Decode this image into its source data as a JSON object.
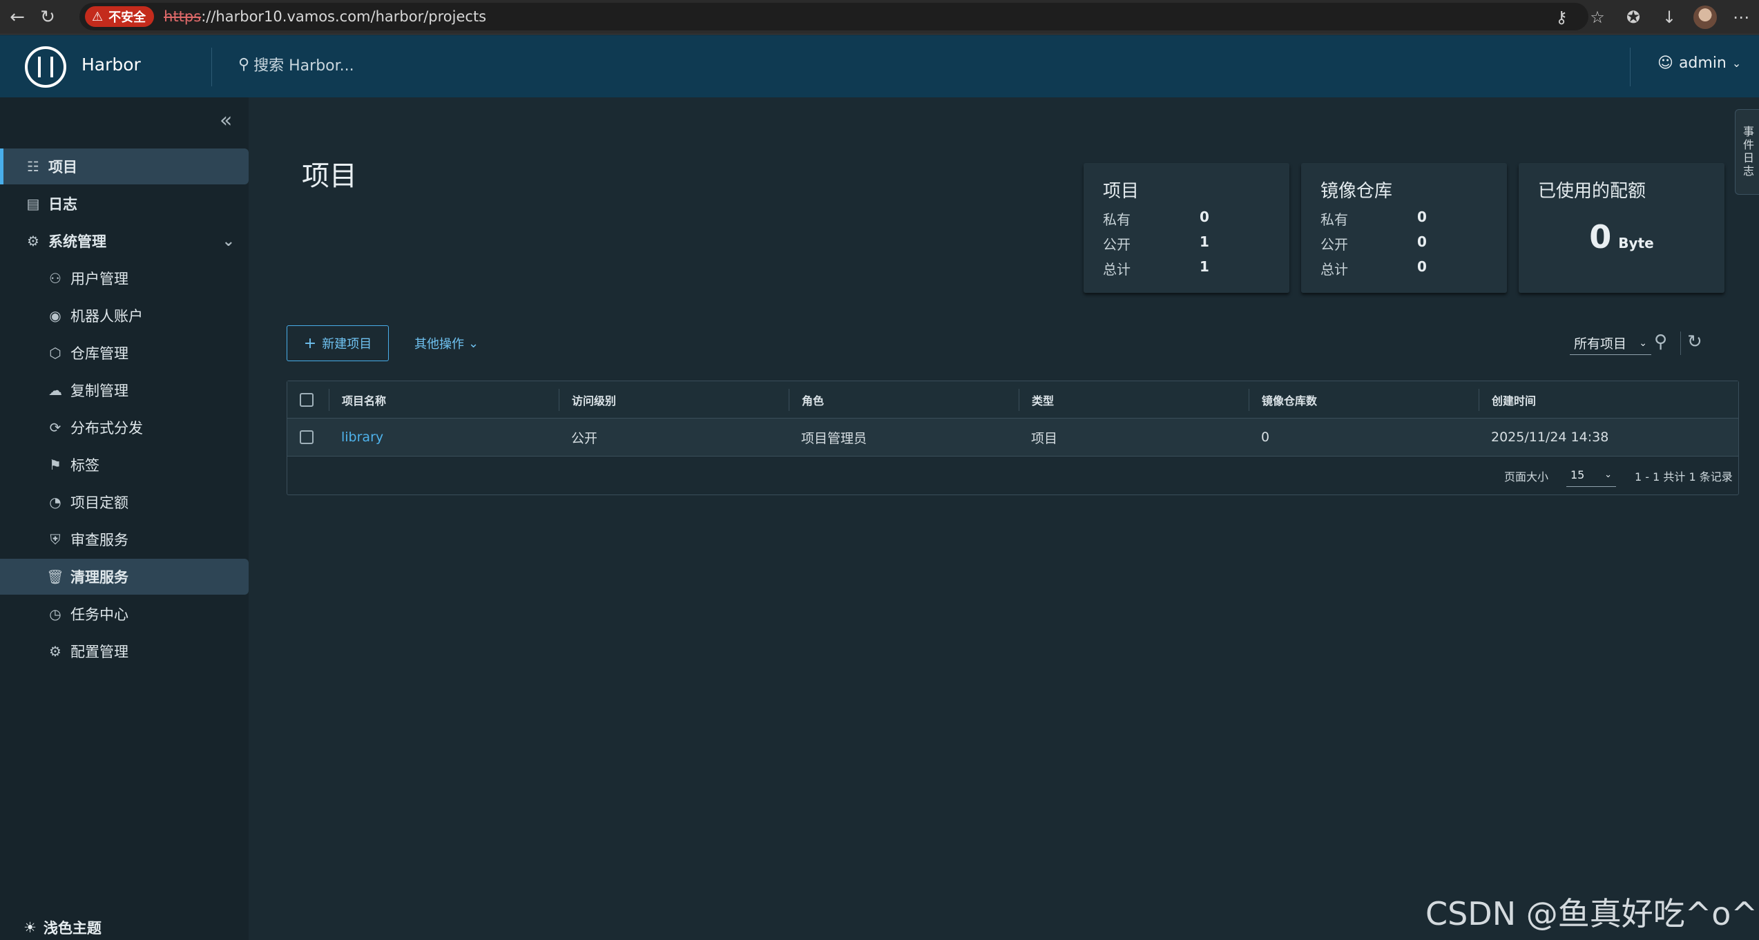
{
  "browser": {
    "security_label": "不安全",
    "url_scheme": "https",
    "url_rest": "://harbor10.vamos.com/harbor/projects"
  },
  "header": {
    "brand": "Harbor",
    "search_placeholder": "搜索 Harbor...",
    "user": "admin"
  },
  "sidebar": {
    "items": [
      {
        "label": "项目",
        "icon": "projects-icon"
      },
      {
        "label": "日志",
        "icon": "log-icon"
      },
      {
        "label": "系统管理",
        "icon": "admin-icon"
      },
      {
        "label": "用户管理",
        "icon": "users-icon"
      },
      {
        "label": "机器人账户",
        "icon": "robot-icon"
      },
      {
        "label": "仓库管理",
        "icon": "registry-icon"
      },
      {
        "label": "复制管理",
        "icon": "replication-icon"
      },
      {
        "label": "分布式分发",
        "icon": "share-icon"
      },
      {
        "label": "标签",
        "icon": "tag-icon"
      },
      {
        "label": "项目定额",
        "icon": "quota-icon"
      },
      {
        "label": "审查服务",
        "icon": "shield-icon"
      },
      {
        "label": "清理服务",
        "icon": "trash-icon"
      },
      {
        "label": "任务中心",
        "icon": "dashboard-icon"
      },
      {
        "label": "配置管理",
        "icon": "gear-icon"
      }
    ],
    "theme_toggle": "浅色主题"
  },
  "edge_tab": "事件日志",
  "main": {
    "title": "项目",
    "cards": {
      "projects": {
        "title": "项目",
        "rows": [
          {
            "label": "私有",
            "value": "0"
          },
          {
            "label": "公开",
            "value": "1"
          },
          {
            "label": "总计",
            "value": "1"
          }
        ]
      },
      "repos": {
        "title": "镜像仓库",
        "rows": [
          {
            "label": "私有",
            "value": "0"
          },
          {
            "label": "公开",
            "value": "0"
          },
          {
            "label": "总计",
            "value": "0"
          }
        ]
      },
      "quota": {
        "title": "已使用的配额",
        "value": "0",
        "unit": "Byte"
      }
    },
    "new_project": "新建项目",
    "more_actions": "其他操作",
    "filter": "所有项目",
    "table": {
      "headers": [
        "项目名称",
        "访问级别",
        "角色",
        "类型",
        "镜像仓库数",
        "创建时间"
      ],
      "rows": [
        [
          "library",
          "公开",
          "项目管理员",
          "项目",
          "0",
          "2025/11/24 14:38"
        ]
      ],
      "page_size_label": "页面大小",
      "page_size": "15",
      "summary": "1 - 1 共计 1 条记录"
    }
  },
  "watermark": "CSDN @鱼真好吃^o^"
}
